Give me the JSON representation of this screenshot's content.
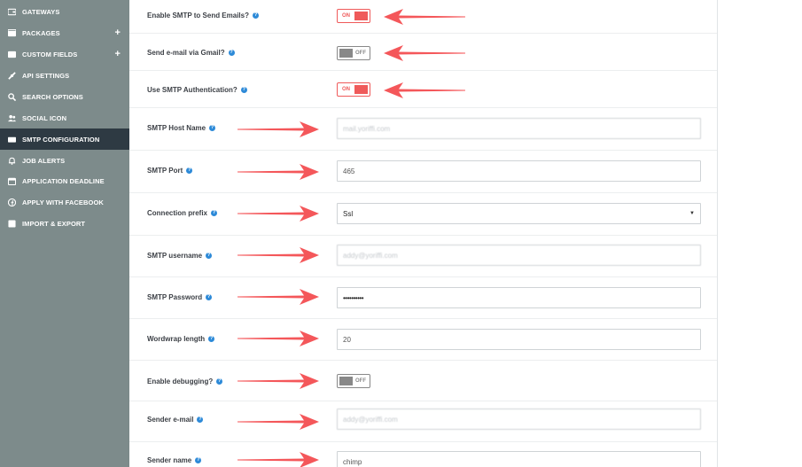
{
  "sidebar": {
    "items": [
      {
        "label": "GATEWAYS",
        "icon": "wallet-icon",
        "plus": false,
        "active": false
      },
      {
        "label": "PACKAGES",
        "icon": "package-icon",
        "plus": true,
        "active": false
      },
      {
        "label": "CUSTOM FIELDS",
        "icon": "list-icon",
        "plus": true,
        "active": false
      },
      {
        "label": "API SETTINGS",
        "icon": "link-icon",
        "plus": false,
        "active": false
      },
      {
        "label": "SEARCH OPTIONS",
        "icon": "search-icon",
        "plus": false,
        "active": false
      },
      {
        "label": "SOCIAL ICON",
        "icon": "users-icon",
        "plus": false,
        "active": false
      },
      {
        "label": "SMTP CONFIGURATION",
        "icon": "mail-icon",
        "plus": false,
        "active": true
      },
      {
        "label": "JOB ALERTS",
        "icon": "bell-icon",
        "plus": false,
        "active": false
      },
      {
        "label": "APPLICATION DEADLINE",
        "icon": "calendar-icon",
        "plus": false,
        "active": false
      },
      {
        "label": "APPLY WITH FACEBOOK",
        "icon": "facebook-icon",
        "plus": false,
        "active": false
      },
      {
        "label": "IMPORT & EXPORT",
        "icon": "import-export-icon",
        "plus": false,
        "active": false
      }
    ],
    "plus_symbol": "+"
  },
  "form": {
    "enable_smtp": {
      "label": "Enable SMTP to Send Emails?",
      "state": "ON"
    },
    "gmail": {
      "label": "Send e-mail via Gmail?",
      "state": "OFF"
    },
    "smtp_auth": {
      "label": "Use SMTP Authentication?",
      "state": "ON"
    },
    "host": {
      "label": "SMTP Host Name",
      "value": "mail.yoriffi.com"
    },
    "port": {
      "label": "SMTP Port",
      "value": "465"
    },
    "prefix": {
      "label": "Connection prefix",
      "value": "Ssl"
    },
    "username": {
      "label": "SMTP username",
      "value": "addy@yoriffi.com"
    },
    "password": {
      "label": "SMTP Password",
      "value": "••••••••••"
    },
    "wordwrap": {
      "label": "Wordwrap length",
      "value": "20"
    },
    "debugging": {
      "label": "Enable debugging?",
      "state": "OFF"
    },
    "sender_email": {
      "label": "Sender e-mail",
      "value": "addy@yoriffi.com"
    },
    "sender_name": {
      "label": "Sender name",
      "value": "chimp"
    }
  },
  "help_symbol": "?",
  "colors": {
    "accent": "#ef5a5a",
    "sidebar": "#7d8b8b",
    "sidebar_active": "#2e3a43",
    "help": "#2d8ad8",
    "arrow": "#f4575a"
  }
}
